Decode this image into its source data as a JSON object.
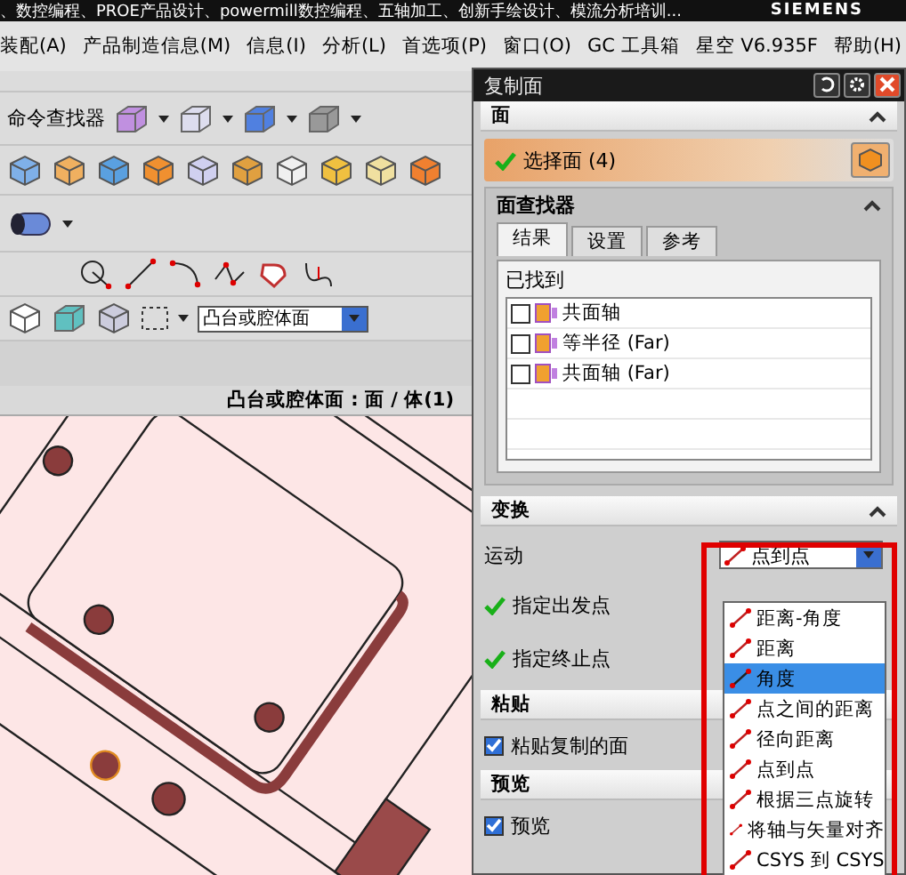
{
  "titlebar": {
    "text": "、数控编程、PROE产品设计、powermill数控编程、五轴加工、创新手绘设计、模流分析培训...",
    "brand": "SIEMENS"
  },
  "menu": [
    "装配(A)",
    "产品制造信息(M)",
    "信息(I)",
    "分析(L)",
    "首选项(P)",
    "窗口(O)",
    "GC 工具箱",
    "星空 V6.935F",
    "帮助(H)"
  ],
  "toolbar": {
    "command_finder": "命令查找器",
    "selection_filter": "凸台或腔体面"
  },
  "graphics": {
    "header": "凸台或腔体面 : 面 / 体(1)"
  },
  "dialog": {
    "title": "复制面",
    "face": {
      "title": "面",
      "expanded": true,
      "select_label": "选择面 (4)",
      "done": true
    },
    "finder": {
      "title": "面查找器",
      "expanded": true,
      "found_label": "已找到",
      "tabs": [
        {
          "label": "结果",
          "selected": true
        },
        {
          "label": "设置",
          "selected": false
        },
        {
          "label": "参考",
          "selected": false
        }
      ],
      "results": [
        {
          "label": "共面轴",
          "checked": false
        },
        {
          "label": "等半径 (Far)",
          "checked": false
        },
        {
          "label": "共面轴 (Far)",
          "checked": false
        }
      ]
    },
    "transform": {
      "title": "变换",
      "expanded": true,
      "motion_label": "运动",
      "motion_value": "点到点",
      "points": [
        {
          "label": "指定出发点",
          "done": true
        },
        {
          "label": "指定终止点",
          "done": true
        }
      ],
      "options": [
        {
          "label": "距离-角度",
          "selected": false
        },
        {
          "label": "距离",
          "selected": false
        },
        {
          "label": "角度",
          "selected": true
        },
        {
          "label": "点之间的距离",
          "selected": false
        },
        {
          "label": "径向距离",
          "selected": false
        },
        {
          "label": "点到点",
          "selected": false
        },
        {
          "label": "根据三点旋转",
          "selected": false
        },
        {
          "label": "将轴与矢量对齐",
          "selected": false
        },
        {
          "label": "CSYS 到 CSYS",
          "selected": false
        }
      ]
    },
    "paste": {
      "title": "粘贴",
      "label": "粘贴复制的面",
      "checked": true
    },
    "preview": {
      "title": "预览",
      "label": "预览",
      "checked": true
    }
  }
}
